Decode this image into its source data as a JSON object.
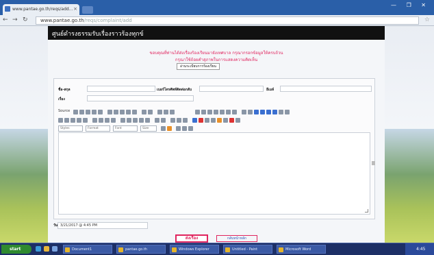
{
  "browser": {
    "tab_title": "www.pantae.go.th/reqs/add...",
    "address_host": "www.pantae.go.th",
    "address_path": "/reqs/complaint/add",
    "window_controls": "— ❐ ✕"
  },
  "page": {
    "banner_title": "ศูนย์ดำรงธรรมรับเรื่องราวร้องทุกข์",
    "notice_line1": "ขอบคุณที่ท่านได้ส่งเรื่องร้องเรียนมายังเทศบาล กรุณากรอกข้อมูลให้ครบถ้วน",
    "notice_line2": "กรุณาใช้ถ้อยคำสุภาพในการแสดงความคิดเห็น",
    "rules_button": "อ่านระเบียบการร้องเรียน",
    "form": {
      "name_label": "ชื่อ-สกุล",
      "phone_label": "เบอร์โทรศัพท์ติดต่อกลับ",
      "email_label": "อีเมล์",
      "subject_label": "เรื่อง"
    },
    "toolbar": {
      "source_label": "Source",
      "format_select": "Format",
      "font_select": "Font",
      "size_select": "Size",
      "style_select": "Styles"
    },
    "date_label": "วันที่",
    "date_value": "3/21/2017 @ 4:45 PM",
    "submit_button": "ส่งเรื่อง",
    "back_link": "กลับหน้าหลัก"
  },
  "taskbar": {
    "start_label": "start",
    "tasks": [
      "Document1",
      "pantae.go.th",
      "Windows Explorer",
      "Untitled - Paint",
      "Microsoft Word"
    ],
    "clock": "4:45"
  },
  "colors": {
    "tabstrip": "#2a5fa8",
    "banner": "#111111",
    "notice": "#e0245e",
    "taskbar": "#1d2f66",
    "start": "#2f8a2f"
  }
}
